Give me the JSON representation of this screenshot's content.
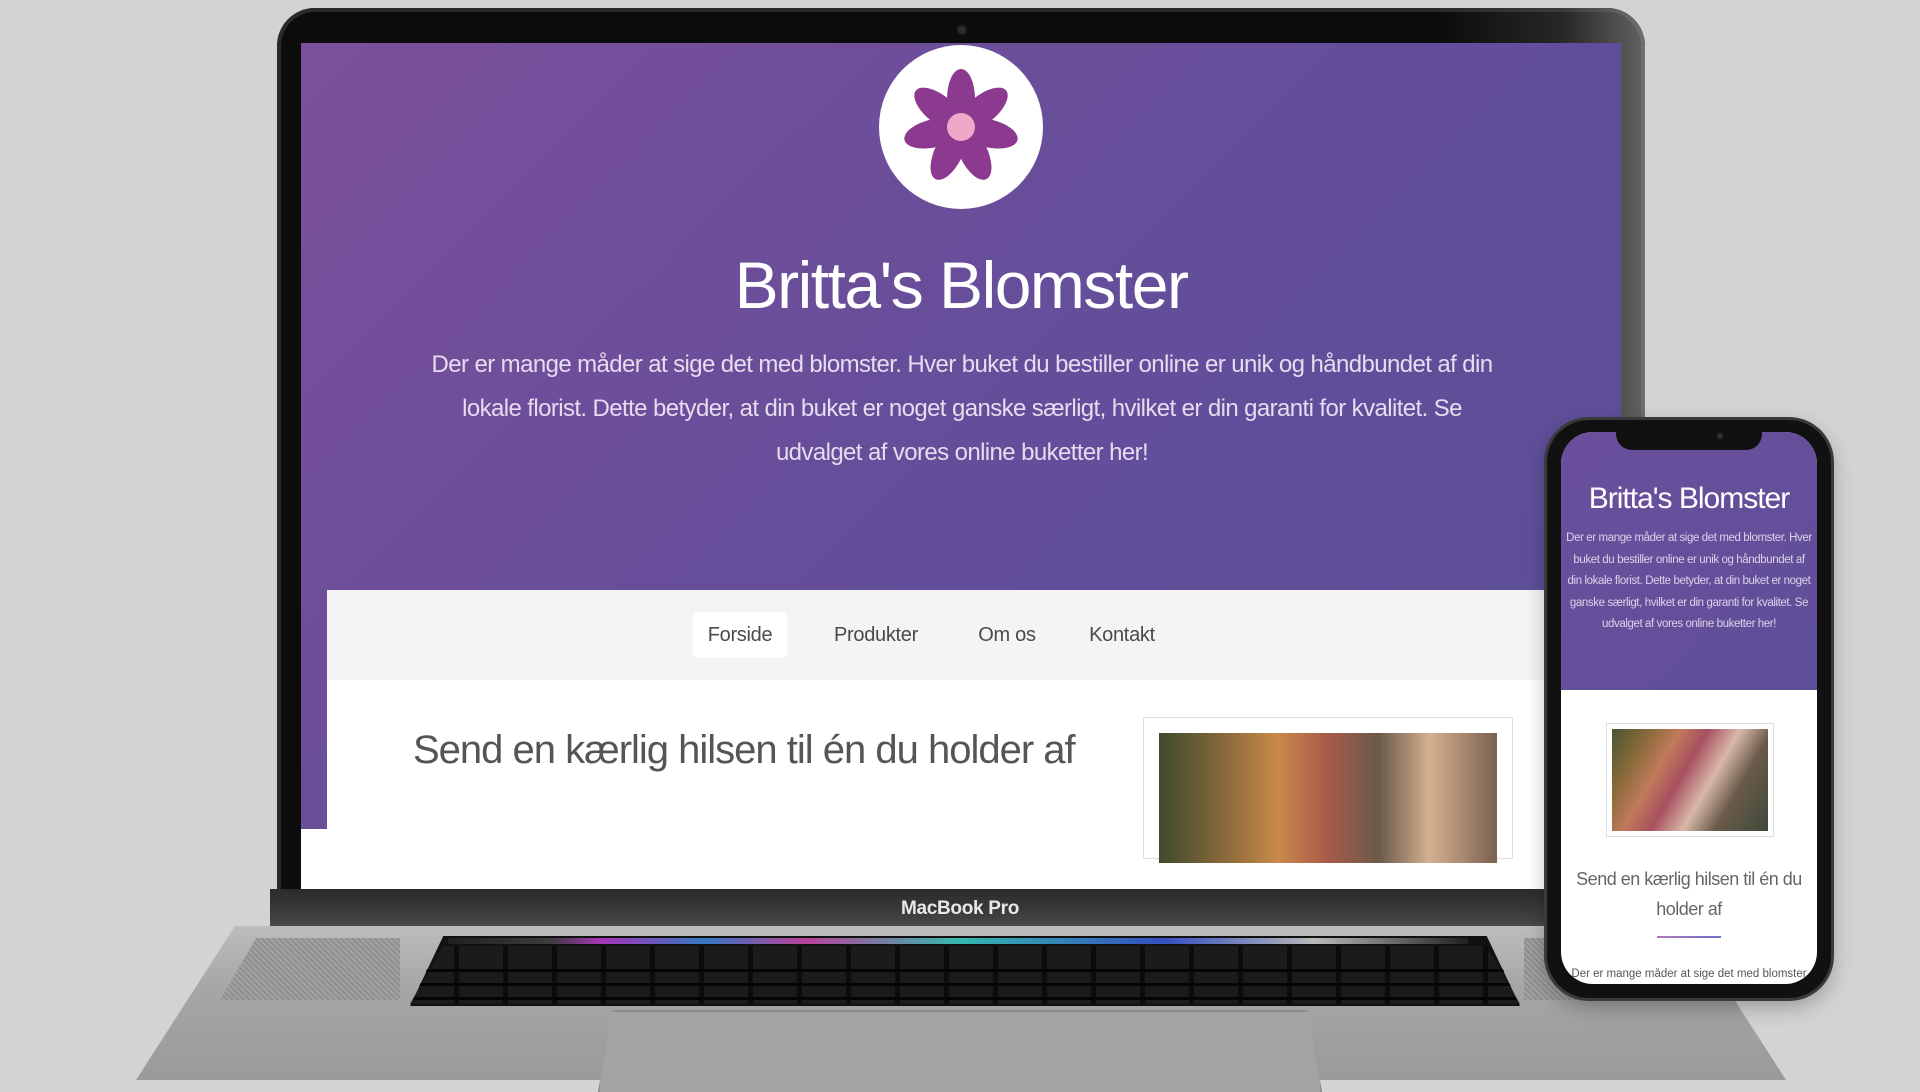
{
  "site": {
    "title": "Britta's Blomster",
    "hero_text": "Der er mange måder at sige det med blomster. Hver buket du bestiller online er unik og håndbundet af din lokale florist. Dette betyder, at din buket er noget ganske særligt, hvilket er din garanti for kvalitet. Se udvalget af vores online buketter her!",
    "nav": [
      {
        "label": "Forside",
        "active": true
      },
      {
        "label": "Produkter",
        "active": false
      },
      {
        "label": "Om os",
        "active": false
      },
      {
        "label": "Kontakt",
        "active": false
      }
    ],
    "content_heading": "Send en kærlig hilsen til én du holder af"
  },
  "device": {
    "brand_label": "MacBook Pro"
  },
  "phone": {
    "title": "Britta's Blomster",
    "hero_text": "Der er mange måder at sige det med blomster. Hver buket du bestiller online er unik og håndbundet af din lokale florist. Dette betyder, at din buket er noget ganske særligt, hvilket er din garanti for kvalitet. Se udvalget af vores online buketter her!",
    "content_heading": "Send en kærlig hilsen til én du holder af",
    "bottom_text": "Der er mange måder at sige det med blomster"
  },
  "colors": {
    "hero_gradient_start": "#7b4f9b",
    "hero_gradient_end": "#5c4f98",
    "flower": "#8b3a8f",
    "flower_center": "#f0a8c8",
    "nav_background": "#f4f4f4",
    "page_background": "#d3d3d3"
  },
  "icons": {
    "logo": "flower-icon",
    "camera": "camera-icon"
  }
}
